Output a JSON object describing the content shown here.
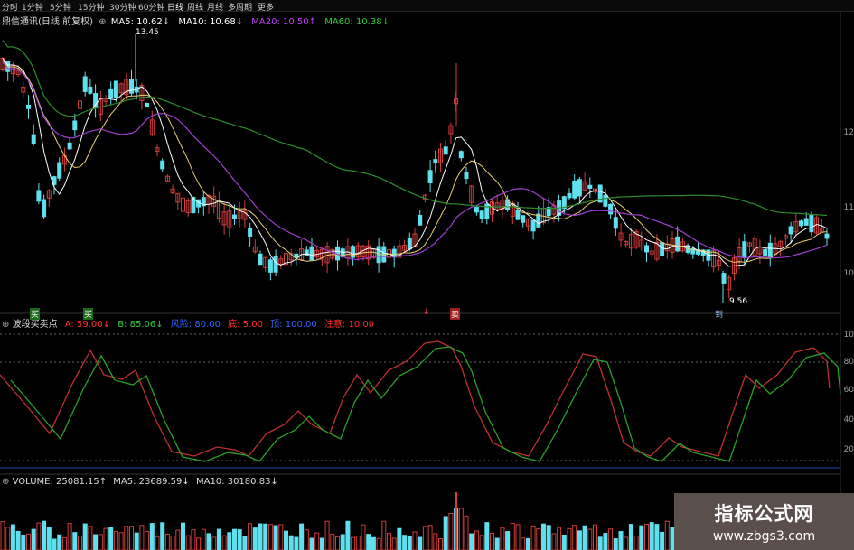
{
  "toolbar": {
    "items": [
      "分时",
      "1分钟",
      "5分钟",
      "15分钟",
      "30分钟",
      "60分钟",
      "日线",
      "周线",
      "月线",
      "多周期",
      "更多"
    ],
    "active_index": 6
  },
  "price_panel": {
    "stock_title": "鼎信通讯(日线 前复权)",
    "ma_items": [
      {
        "label": "MA5: 10.62↓",
        "color": "#ffffff"
      },
      {
        "label": "MA10: 10.68↓",
        "color": "#ffffff"
      },
      {
        "label": "MA20: 10.50↑",
        "color": "#c040ff"
      },
      {
        "label": "MA60: 10.38↓",
        "color": "#33cc33"
      }
    ],
    "high_label": "13.45",
    "low_label": "9.56",
    "axis_ticks": [
      "12",
      "11",
      "10"
    ]
  },
  "indicator_panel": {
    "title": "波段买卖点",
    "items": [
      {
        "label": "A: 59.00↓",
        "color": "#ff3030"
      },
      {
        "label": "B: 85.06↓",
        "color": "#33cc33"
      },
      {
        "label": "风险: 80.00",
        "color": "#3366ff"
      },
      {
        "label": "底: 5.00",
        "color": "#ff3030"
      },
      {
        "label": "顶: 100.00",
        "color": "#3366ff"
      },
      {
        "label": "注意: 10.00",
        "color": "#ff3030"
      }
    ],
    "axis_ticks": [
      "10",
      "80",
      "60",
      "40",
      "20"
    ]
  },
  "volume_panel": {
    "items": [
      {
        "label": "VOLUME: 25081.15↑",
        "color": "#dddddd"
      },
      {
        "label": "MA5: 23689.59↓",
        "color": "#dddddd"
      },
      {
        "label": "MA10: 30180.83↓",
        "color": "#dddddd"
      }
    ]
  },
  "signals": {
    "buy_label": "买",
    "sell_label": "卖",
    "low_label": "到"
  },
  "watermark": {
    "title": "指标公式网",
    "url": "www.zbgs3.com"
  },
  "colors": {
    "up": "#d23c3c",
    "down": "#5fe0ee",
    "ma5": "#ffffff",
    "ma10": "#e8d070",
    "ma20": "#a040d0",
    "ma60": "#2e8b2e",
    "line_a": "#c03030",
    "line_b": "#2aa02a"
  }
}
